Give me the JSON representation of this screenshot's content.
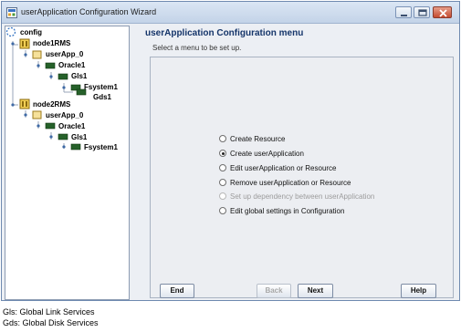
{
  "window": {
    "title": "userApplication Configuration Wizard",
    "icon": "wizard-app-icon",
    "controls": [
      "minimize-icon",
      "maximize-icon",
      "close-icon"
    ],
    "close_color": "#c9543a"
  },
  "tree": {
    "root": "config",
    "nodes": [
      {
        "label": "node1RMS",
        "icon": "rms-node-icon"
      },
      {
        "label": "userApp_0",
        "icon": "userapp-icon"
      },
      {
        "label": "Oracle1",
        "icon": "resource-icon"
      },
      {
        "label": "Gls1",
        "icon": "resource-icon"
      },
      {
        "label": "Fsystem1",
        "icon": "resource-icon"
      },
      {
        "label": "Gds1",
        "icon": "resource-icon"
      },
      {
        "label": "node2RMS",
        "icon": "rms-node-icon"
      },
      {
        "label": "userApp_0",
        "icon": "userapp-icon"
      },
      {
        "label": "Oracle1",
        "icon": "resource-icon"
      },
      {
        "label": "Gls1",
        "icon": "resource-icon"
      },
      {
        "label": "Fsystem1",
        "icon": "resource-icon"
      }
    ]
  },
  "menu": {
    "title": "userApplication Configuration menu",
    "subtitle": "Select a menu to be set up.",
    "options": [
      {
        "label": "Create Resource",
        "selected": false,
        "enabled": true
      },
      {
        "label": "Create userApplication",
        "selected": true,
        "enabled": true
      },
      {
        "label": "Edit userApplication or Resource",
        "selected": false,
        "enabled": true
      },
      {
        "label": "Remove userApplication or Resource",
        "selected": false,
        "enabled": true
      },
      {
        "label": "Set up dependency between userApplication",
        "selected": false,
        "enabled": false
      },
      {
        "label": "Edit global settings in Configuration",
        "selected": false,
        "enabled": true
      }
    ]
  },
  "buttons": {
    "end": "End",
    "back": "Back",
    "next": "Next",
    "help": "Help"
  },
  "legend": {
    "line1": "Gls: Global Link Services",
    "line2": "Gds: Global Disk Services"
  }
}
